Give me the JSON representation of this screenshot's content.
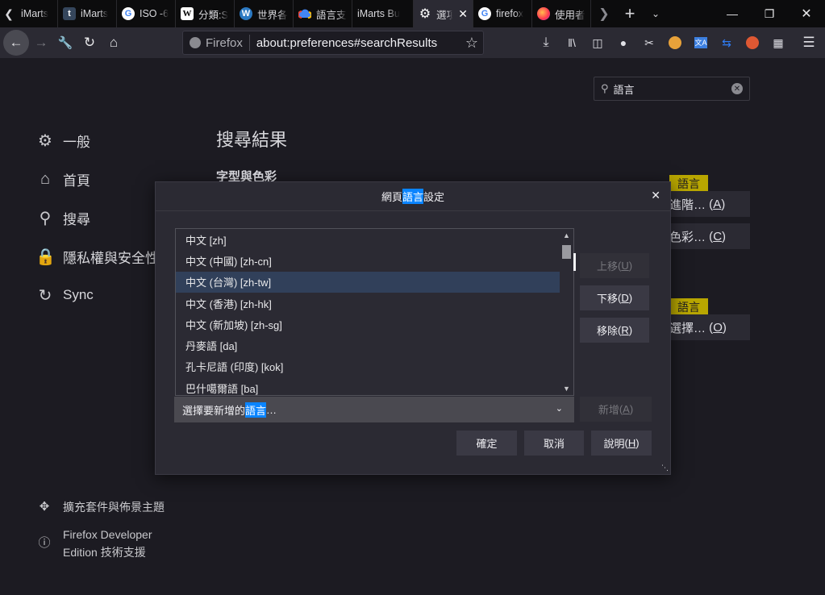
{
  "tabs": [
    {
      "label": "iMarts",
      "icon": "blank"
    },
    {
      "label": "iMarts",
      "icon": "tumblr-icon"
    },
    {
      "label": "ISO -6",
      "icon": "google-icon"
    },
    {
      "label": "分類:S",
      "icon": "wikipedia-icon"
    },
    {
      "label": "世界各",
      "icon": "wordpress-icon"
    },
    {
      "label": "語言支",
      "icon": "google-cloud-icon"
    },
    {
      "label": "iMarts Bu",
      "icon": "blank"
    },
    {
      "label": "選項",
      "icon": "gear-icon"
    },
    {
      "label": "firefox",
      "icon": "google-icon"
    },
    {
      "label": "使用者",
      "icon": "firefox-icon"
    }
  ],
  "navbar": {
    "identity_label": "Firefox",
    "url": "about:preferences#searchResults"
  },
  "search": {
    "value": "語言"
  },
  "sidebar": {
    "items": [
      {
        "label": "一般",
        "icon": "gear-icon"
      },
      {
        "label": "首頁",
        "icon": "home-icon"
      },
      {
        "label": "搜尋",
        "icon": "search-icon"
      },
      {
        "label": "隱私權與安全性",
        "icon": "lock-icon"
      },
      {
        "label": "Sync",
        "icon": "sync-icon"
      }
    ],
    "footer": [
      {
        "label": "擴充套件與佈景主題",
        "icon": "puzzle-icon"
      },
      {
        "label": "Firefox Developer Edition 技術支援",
        "line1": "Firefox Developer",
        "line2": "Edition 技術支援",
        "icon": "help-icon"
      }
    ]
  },
  "main": {
    "title": "搜尋結果",
    "section": "字型與色彩",
    "badge1": "語言",
    "badge2": "語言",
    "btn_advanced_text": "進階…",
    "btn_advanced_key": "A",
    "btn_colors_text": "色彩…",
    "btn_colors_key": "C",
    "btn_choose_text": "選擇…",
    "btn_choose_key": "O"
  },
  "dialog": {
    "title_pre": "網頁",
    "title_hl": "語言",
    "title_post": "設定",
    "languages": [
      "中文  [zh]",
      "中文 (中國)  [zh-cn]",
      "中文 (台灣)  [zh-tw]",
      "中文 (香港)  [zh-hk]",
      "中文 (新加坡)  [zh-sg]",
      "丹麥語  [da]",
      "孔卡尼語 (印度)  [kok]",
      "巴什噶爾語  [ba]"
    ],
    "selected_index": 2,
    "move_up": {
      "text": "上移 ",
      "key": "U"
    },
    "move_down": {
      "text": "下移 ",
      "key": "D"
    },
    "remove": {
      "text": "移除 ",
      "key": "R"
    },
    "select_pre": "選擇要新增的",
    "select_hl": "語言",
    "select_post": "…",
    "add": {
      "text": "新增 ",
      "key": "A"
    },
    "ok": "確定",
    "cancel": "取消",
    "help": {
      "text": "說明 ",
      "key": "H"
    }
  }
}
